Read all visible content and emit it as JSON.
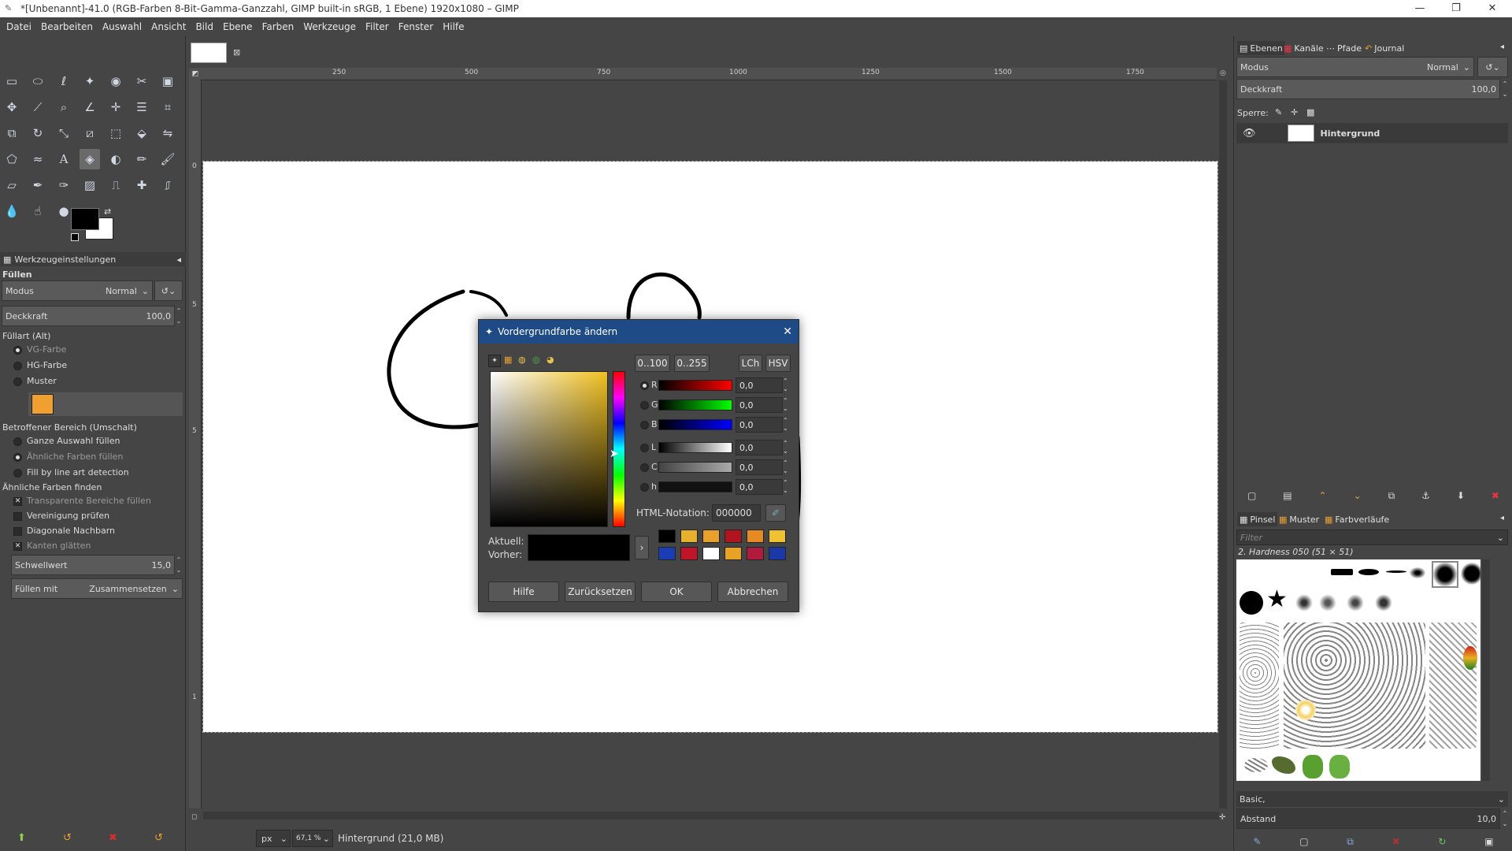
{
  "titlebar": {
    "title": "*[Unbenannt]-41.0 (RGB-Farben 8-Bit-Gamma-Ganzzahl, GIMP built-in sRGB, 1 Ebene) 1920x1080 – GIMP"
  },
  "menu": [
    "Datei",
    "Bearbeiten",
    "Auswahl",
    "Ansicht",
    "Bild",
    "Ebene",
    "Farben",
    "Werkzeuge",
    "Filter",
    "Fenster",
    "Hilfe"
  ],
  "tool_options": {
    "panel_title": "Werkzeugeinstellungen",
    "tool_name": "Füllen",
    "mode_label": "Modus",
    "mode_value": "Normal",
    "opacity_label": "Deckkraft",
    "opacity_value": "100,0",
    "fill_type_label": "Füllart  (Alt)",
    "fill_types": [
      "VG-Farbe",
      "HG-Farbe",
      "Muster"
    ],
    "area_label": "Betroffener Bereich  (Umschalt)",
    "areas": [
      "Ganze Auswahl füllen",
      "Ähnliche Farben füllen",
      "Fill by line art detection"
    ],
    "similar_label": "Ähnliche Farben finden",
    "similar_opts": [
      "Transparente Bereiche füllen",
      "Vereinigung prüfen",
      "Diagonale Nachbarn",
      "Kanten glätten"
    ],
    "threshold_label": "Schwellwert",
    "threshold_value": "15,0",
    "fill_with_label": "Füllen mit",
    "fill_with_value": "Zusammensetzen"
  },
  "rulers": {
    "top": [
      "250",
      "500",
      "750",
      "1000",
      "1250",
      "1500",
      "1750"
    ],
    "left": [
      "0",
      "5",
      "5",
      "1"
    ]
  },
  "status": {
    "unit": "px",
    "zoom": "67,1 %",
    "info": "Hintergrund (21,0 MB)"
  },
  "dock": {
    "tabs": [
      "Ebenen",
      "Kanäle",
      "Pfade",
      "Journal"
    ],
    "mode_label": "Modus",
    "mode_value": "Normal",
    "opacity_label": "Deckkraft",
    "opacity_value": "100,0",
    "lock_label": "Sperre:",
    "layer_name": "Hintergrund",
    "brush_tabs": [
      "Pinsel",
      "Muster",
      "Farbverläufe"
    ],
    "filter_placeholder": "Filter",
    "brush_name": "2. Hardness 050 (51 × 51)",
    "preset": "Basic,",
    "spacing_label": "Abstand",
    "spacing_value": "10,0"
  },
  "dialog": {
    "title": "Vordergrundfarbe ändern",
    "range_buttons": [
      "0..100",
      "0..255",
      "LCh",
      "HSV"
    ],
    "channels": [
      {
        "label": "R",
        "value": "0,0"
      },
      {
        "label": "G",
        "value": "0,0"
      },
      {
        "label": "B",
        "value": "0,0"
      },
      {
        "label": "L",
        "value": "0,0"
      },
      {
        "label": "C",
        "value": "0,0"
      },
      {
        "label": "h",
        "value": "0,0"
      }
    ],
    "html_label": "HTML-Notation:",
    "html_value": "000000",
    "current_label": "Aktuell:",
    "previous_label": "Vorher:",
    "buttons": [
      "Hilfe",
      "Zurücksetzen",
      "OK",
      "Abbrechen"
    ],
    "history_colors": [
      "#000000",
      "#e8b12c",
      "#e8a22c",
      "#b0141e",
      "#e68a24",
      "#f0c232",
      "#1a3cb4",
      "#c01428",
      "#ffffff",
      "#e8a224",
      "#b01a3c",
      "#1a38a8"
    ]
  }
}
